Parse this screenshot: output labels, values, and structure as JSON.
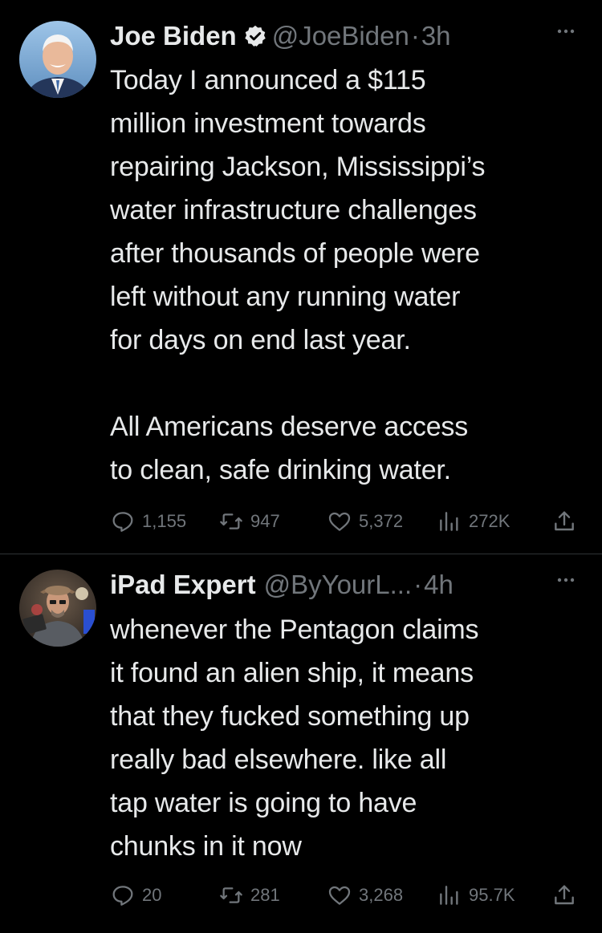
{
  "tweets": [
    {
      "author": {
        "name": "Joe Biden",
        "verified": true,
        "handle": "@JoeBiden",
        "time": "3h",
        "avatar": "avatar-photo"
      },
      "text": "Today I announced a $115\nmillion investment towards\nrepairing Jackson, Mississippi’s\nwater infrastructure challenges\nafter thousands of people were\nleft without any running water\nfor days on end last year.\n\nAll Americans deserve access\nto clean, safe drinking water.",
      "stats": {
        "replies": "1,155",
        "retweets": "947",
        "likes": "5,372",
        "views": "272K"
      }
    },
    {
      "author": {
        "name": "iPad Expert",
        "verified": false,
        "handle": "@ByYourL...",
        "time": "4h",
        "avatar": "avatar-photo"
      },
      "text": "whenever the Pentagon claims\nit found an alien ship, it means\nthat they fucked something up\nreally bad elsewhere. like all\ntap water is going to have\nchunks in it now",
      "stats": {
        "replies": "20",
        "retweets": "281",
        "likes": "3,268",
        "views": "95.7K"
      }
    }
  ],
  "ui": {
    "separator": "·",
    "icons": {
      "more": "more-icon",
      "verified": "verified-badge-icon",
      "reply": "reply-icon",
      "retweet": "retweet-icon",
      "like": "heart-icon",
      "views": "views-icon",
      "share": "share-icon"
    },
    "colors": {
      "background": "#000000",
      "text": "#e7e9ea",
      "secondary": "#71767b",
      "divider": "#2f3336",
      "verified_badge": "#e7e9ea"
    }
  }
}
